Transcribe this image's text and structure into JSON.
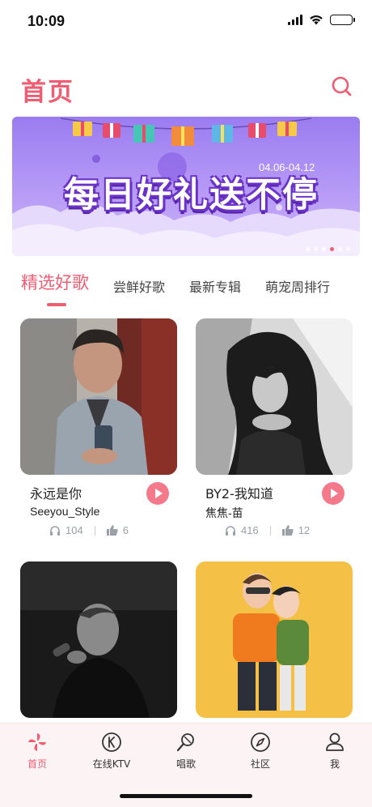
{
  "status_bar": {
    "time": "10:09"
  },
  "header": {
    "title": "首页",
    "search_icon": "search-icon"
  },
  "banner": {
    "headline": "每日好礼送不停",
    "date_range": "04.06-04.12",
    "slide_count": 6,
    "active_slide": 4,
    "colors": {
      "bg": "#a07ff2",
      "headline_outline": "#6b32c8"
    }
  },
  "tabs": [
    {
      "label": "精选好歌",
      "active": true
    },
    {
      "label": "尝鲜好歌",
      "active": false
    },
    {
      "label": "最新专辑",
      "active": false
    },
    {
      "label": "萌宠周排行",
      "active": false
    }
  ],
  "songs": [
    {
      "title": "永远是你",
      "artist": "Seeyou_Style",
      "listens": "104",
      "likes": "6"
    },
    {
      "title": "BY2-我知道",
      "artist": "焦焦-苗",
      "listens": "416",
      "likes": "12"
    },
    {
      "title": "",
      "artist": "",
      "listens": "",
      "likes": ""
    },
    {
      "title": "",
      "artist": "",
      "listens": "",
      "likes": ""
    }
  ],
  "bottom_nav": [
    {
      "label": "首页",
      "icon": "pinwheel-icon",
      "active": true
    },
    {
      "label": "在线KTV",
      "icon": "ktv-icon",
      "active": false
    },
    {
      "label": "唱歌",
      "icon": "microphone-icon",
      "active": false
    },
    {
      "label": "社区",
      "icon": "compass-icon",
      "active": false
    },
    {
      "label": "我",
      "icon": "profile-icon",
      "active": false
    }
  ],
  "colors": {
    "accent": "#ef5d73",
    "play_button": "#f47a8b",
    "stat_gray": "#9aa0a8"
  }
}
